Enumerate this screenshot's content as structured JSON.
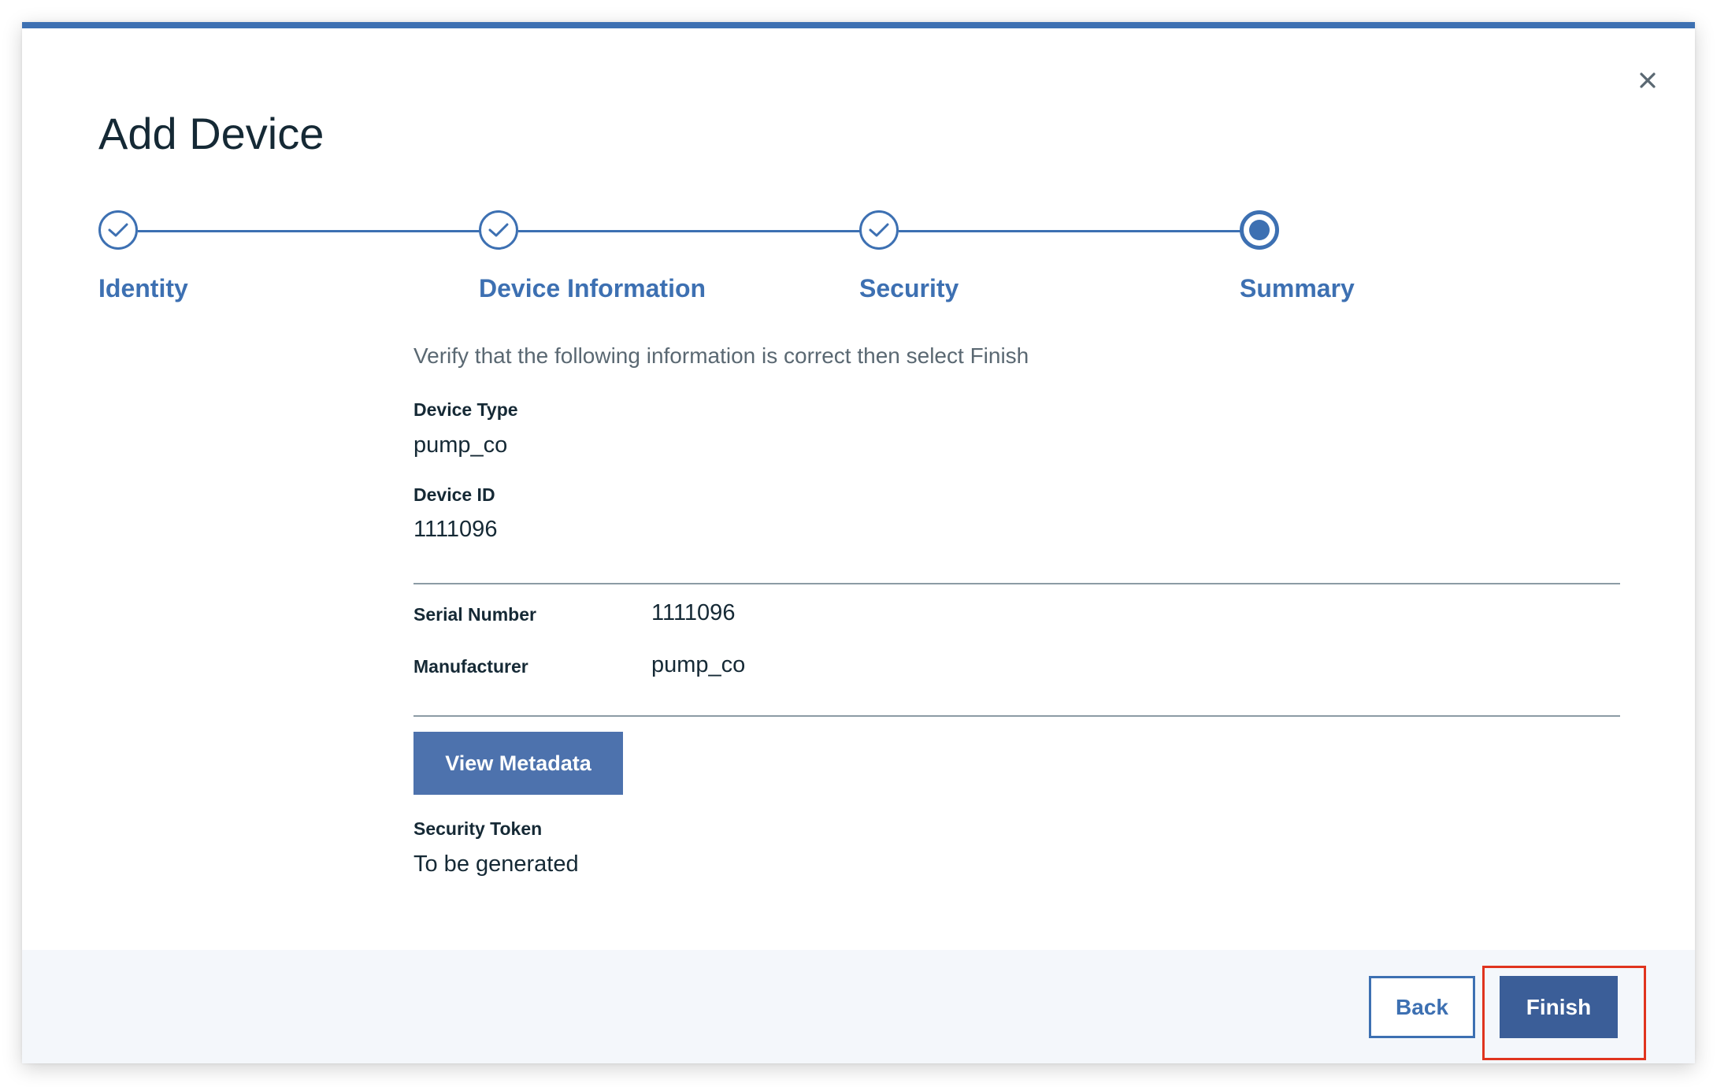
{
  "modal": {
    "title": "Add Device",
    "close_icon": "close-icon"
  },
  "progress": {
    "steps": [
      {
        "label": "Identity",
        "state": "complete"
      },
      {
        "label": "Device Information",
        "state": "complete"
      },
      {
        "label": "Security",
        "state": "complete"
      },
      {
        "label": "Summary",
        "state": "current"
      }
    ]
  },
  "summary": {
    "intro": "Verify that the following information is correct then select Finish",
    "device_type_label": "Device Type",
    "device_type_value": "pump_co",
    "device_id_label": "Device ID",
    "device_id_value": "1111096",
    "serial_number_label": "Serial Number",
    "serial_number_value": "1111096",
    "manufacturer_label": "Manufacturer",
    "manufacturer_value": "pump_co",
    "view_metadata_label": "View Metadata",
    "security_token_label": "Security Token",
    "security_token_value": "To be generated"
  },
  "footer": {
    "back_label": "Back",
    "finish_label": "Finish"
  },
  "colors": {
    "accent": "#3d70b2",
    "primary_button": "#3b5e98",
    "metadata_button": "#4d72ad",
    "highlight": "#e0341e",
    "footer_bg": "#f4f7fb"
  }
}
